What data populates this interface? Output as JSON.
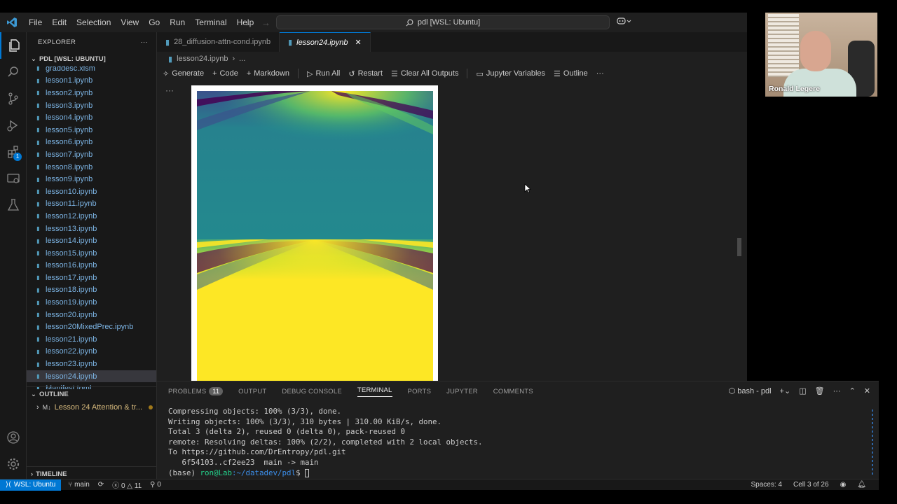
{
  "titlebar": {
    "menu": [
      "File",
      "Edit",
      "Selection",
      "View",
      "Go",
      "Run",
      "Terminal",
      "Help"
    ],
    "command_center": "pdl [WSL: Ubuntu]"
  },
  "explorer": {
    "title": "EXPLORER",
    "more": "···",
    "root": "PDL [WSL: UBUNTU]",
    "files": [
      "graddesc.xlsm",
      "lesson1.ipynb",
      "lesson2.ipynb",
      "lesson3.ipynb",
      "lesson4.ipynb",
      "lesson5.ipynb",
      "lesson6.ipynb",
      "lesson7.ipynb",
      "lesson8.ipynb",
      "lesson9.ipynb",
      "lesson10.ipynb",
      "lesson11.ipynb",
      "lesson12.ipynb",
      "lesson13.ipynb",
      "lesson14.ipynb",
      "lesson15.ipynb",
      "lesson16.ipynb",
      "lesson17.ipynb",
      "lesson18.ipynb",
      "lesson19.ipynb",
      "lesson20.ipynb",
      "lesson20MixedPrec.ipynb",
      "lesson21.ipynb",
      "lesson22.ipynb",
      "lesson23.ipynb",
      "lesson24.ipynb",
      "Manifest.toml"
    ],
    "selected_index": 25,
    "outline_title": "OUTLINE",
    "outline_item": "Lesson 24 Attention & tr...",
    "outline_prefix": "M↓",
    "timeline_title": "TIMELINE"
  },
  "activity_badge": "1",
  "editor": {
    "tabs": [
      {
        "label": "28_diffusion-attn-cond.ipynb",
        "active": false
      },
      {
        "label": "lesson24.ipynb",
        "active": true
      }
    ],
    "breadcrumb": [
      "lesson24.ipynb",
      "..."
    ],
    "toolbar": {
      "generate": "Generate",
      "code": "Code",
      "markdown": "Markdown",
      "run_all": "Run All",
      "restart": "Restart",
      "clear_outputs": "Clear All Outputs",
      "variables": "Jupyter Variables",
      "outline": "Outline",
      "more": "···"
    },
    "cell_more": "···"
  },
  "webcam": {
    "name": "Ronald Legere"
  },
  "panel": {
    "tabs": [
      "PROBLEMS",
      "OUTPUT",
      "DEBUG CONSOLE",
      "TERMINAL",
      "PORTS",
      "JUPYTER",
      "COMMENTS"
    ],
    "active_tab": "TERMINAL",
    "problems_count": "11",
    "shell_label": "bash - pdl",
    "terminal_lines": [
      "Compressing objects: 100% (3/3), done.",
      "Writing objects: 100% (3/3), 310 bytes | 310.00 KiB/s, done.",
      "Total 3 (delta 2), reused 0 (delta 0), pack-reused 0",
      "remote: Resolving deltas: 100% (2/2), completed with 2 local objects.",
      "To https://github.com/DrEntropy/pdl.git",
      "   6f54103..cf2ee23  main -> main"
    ],
    "prompt_env": "(base)",
    "prompt_user": "ron@Lab",
    "prompt_path": ":~/datadev/pdl",
    "prompt_symbol": "$"
  },
  "statusbar": {
    "remote": "WSL: Ubuntu",
    "branch": "main",
    "errors": "0",
    "warnings": "11",
    "ports": "0",
    "spaces": "Spaces: 4",
    "cell": "Cell 3 of 26"
  },
  "colors": {
    "accent": "#0078d4",
    "viridis_purple": "#440154",
    "viridis_teal": "#21918c",
    "viridis_yellow": "#fde725"
  }
}
